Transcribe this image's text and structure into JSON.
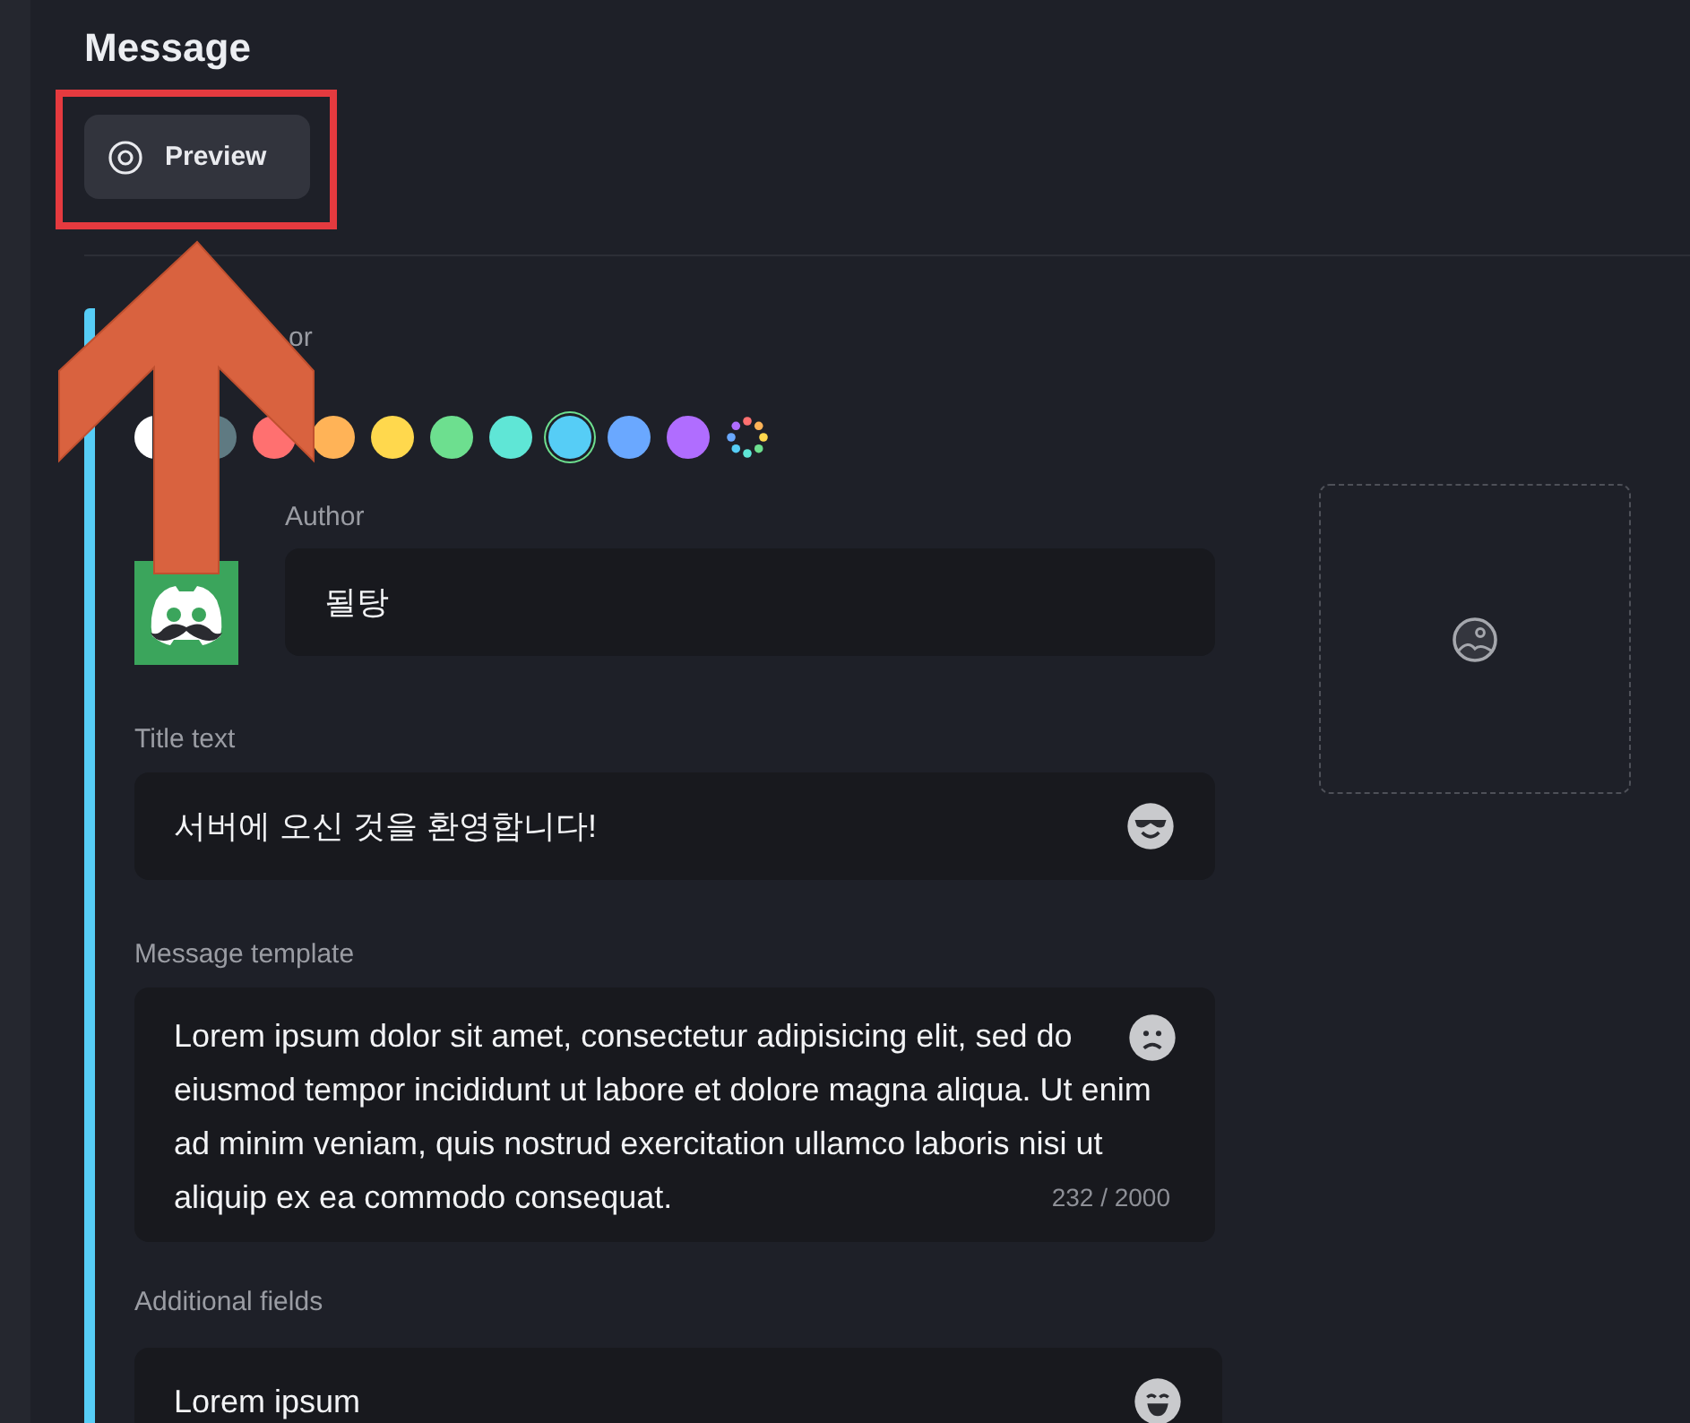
{
  "header": {
    "title": "Message",
    "preview_button": "Preview"
  },
  "embed": {
    "color_label": "or",
    "swatches": [
      {
        "kind": "color",
        "color": "#ffffff",
        "selected": false
      },
      {
        "kind": "color",
        "color": "#5f7a82",
        "selected": false
      },
      {
        "kind": "color",
        "color": "#ff7070",
        "selected": false
      },
      {
        "kind": "color",
        "color": "#ffb357",
        "selected": false
      },
      {
        "kind": "color",
        "color": "#ffd84d",
        "selected": false
      },
      {
        "kind": "color",
        "color": "#6ddf8f",
        "selected": false
      },
      {
        "kind": "color",
        "color": "#5fe6d6",
        "selected": false
      },
      {
        "kind": "color",
        "color": "#56cdf6",
        "selected": true
      },
      {
        "kind": "color",
        "color": "#6aa8ff",
        "selected": false
      },
      {
        "kind": "color",
        "color": "#b06dff",
        "selected": false
      },
      {
        "kind": "picker",
        "selected": false
      }
    ],
    "author": {
      "label": "Author",
      "value": "될탕"
    },
    "title": {
      "label": "Title text",
      "value": "서버에 오신 것을 환영합니다!"
    },
    "message": {
      "label": "Message template",
      "value": "Lorem ipsum dolor sit amet, consectetur adipisicing elit, sed do eiusmod tempor incididunt ut labore et dolore magna aliqua. Ut enim ad minim veniam, quis nostrud exercitation ullamco laboris nisi ut aliquip ex ea commodo consequat.",
      "counter": "232 / 2000"
    },
    "additional": {
      "label": "Additional fields",
      "value": "Lorem ipsum"
    }
  }
}
